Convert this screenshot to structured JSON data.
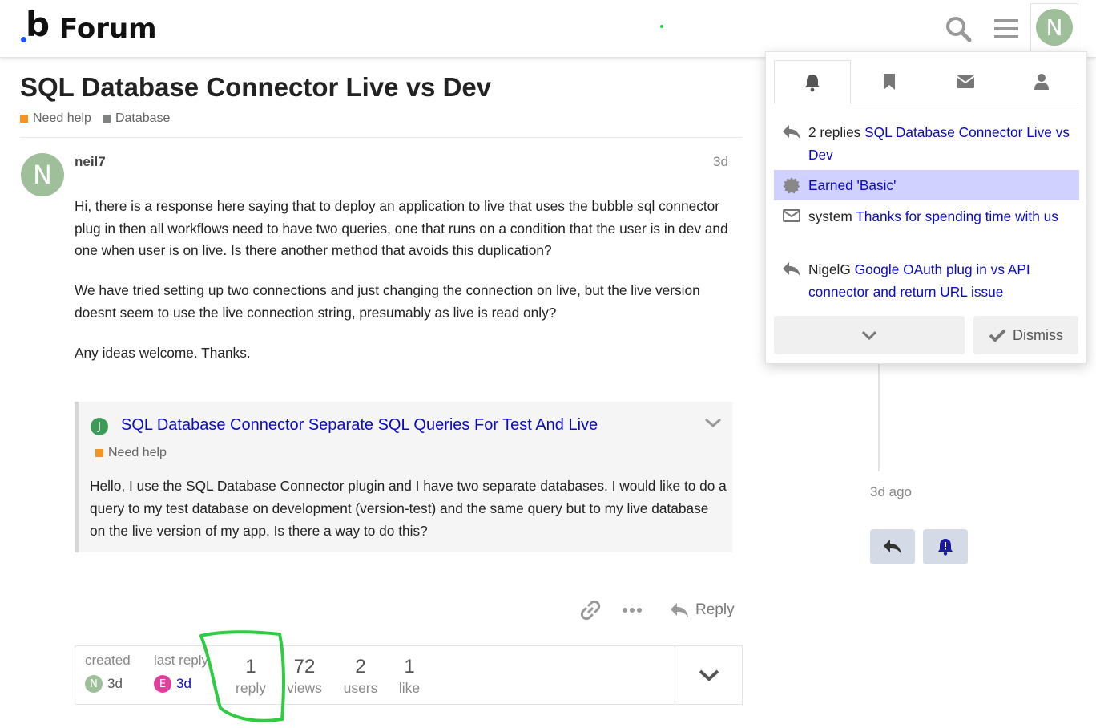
{
  "header": {
    "logo_text": "Forum",
    "avatar_letter": "N",
    "icons": [
      "search-icon",
      "hamburger-menu-icon"
    ]
  },
  "topic": {
    "title": "SQL Database Connector Live vs Dev",
    "categories": [
      {
        "name": "Need help",
        "color": "#f7941d"
      },
      {
        "name": "Database",
        "color": "#808281"
      }
    ]
  },
  "post": {
    "avatar_letter": "N",
    "username": "neil7",
    "date": "3d",
    "paragraphs": [
      "Hi, there is a response here saying that to deploy an application to live that uses the bubble sql connector plug in then all workflows need to have two queries, one that runs on a condition that the user is in dev and one when user is on live. Is there another method that avoids this duplication?",
      "We have tried setting up two connections and just changing the connection on live, but the live version doesnt seem to use the live connection string, presumably as live is read only?",
      "Any ideas welcome. Thanks."
    ],
    "onebox": {
      "avatar_letter": "J",
      "title": "SQL Database Connector Separate SQL Queries For Test And Live",
      "category": "Need help",
      "body": "Hello, I use the SQL Database Connector plugin and I have two separate databases. I would like to do a query to my test database on development (version-test) and the same query but to my live database on the live version of my app. Is there a way to do this?"
    },
    "actions": {
      "reply_label": "Reply"
    }
  },
  "topic_map": {
    "created_label": "created",
    "created_avatar": "N",
    "created_time": "3d",
    "last_reply_label": "last reply",
    "last_reply_avatar": "E",
    "last_reply_time": "3d",
    "stats": [
      {
        "num": "1",
        "label": "reply"
      },
      {
        "num": "72",
        "label": "views"
      },
      {
        "num": "2",
        "label": "users"
      },
      {
        "num": "1",
        "label": "like"
      }
    ]
  },
  "timeline": {
    "date": "3d ago"
  },
  "notifications": {
    "tabs": [
      "bell-icon",
      "bookmark-icon",
      "envelope-icon",
      "user-icon"
    ],
    "items": [
      {
        "icon": "reply-icon",
        "prefix": "2 replies",
        "link": "SQL Database Connector Live vs Dev",
        "highlight": false
      },
      {
        "icon": "badge-icon",
        "prefix": "",
        "link": "Earned 'Basic'",
        "highlight": true
      },
      {
        "icon": "envelope-icon",
        "prefix": "system",
        "link": "Thanks for spending time with us",
        "highlight": false
      },
      {
        "icon": "reply-icon",
        "prefix": "NigelG",
        "link": "Google OAuth plug in vs API connector and return URL issue",
        "highlight": false
      }
    ],
    "dismiss_label": "Dismiss"
  },
  "colors": {
    "accent_link": "#0a0ac4",
    "highlight": "#d1d1ff",
    "annotation": "#2ecc40"
  }
}
